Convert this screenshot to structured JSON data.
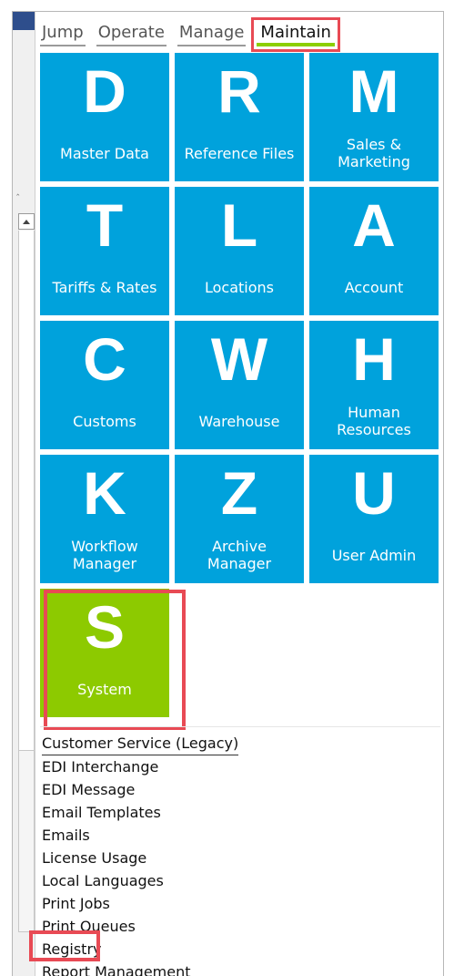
{
  "tabs": [
    {
      "label": "Jump"
    },
    {
      "label": "Operate"
    },
    {
      "label": "Manage"
    },
    {
      "label": "Maintain",
      "active": true
    }
  ],
  "tiles": [
    {
      "letter": "D",
      "label": "Master Data"
    },
    {
      "letter": "R",
      "label": "Reference Files"
    },
    {
      "letter": "M",
      "label": "Sales & Marketing"
    },
    {
      "letter": "T",
      "label": "Tariffs & Rates"
    },
    {
      "letter": "L",
      "label": "Locations"
    },
    {
      "letter": "A",
      "label": "Account"
    },
    {
      "letter": "C",
      "label": "Customs"
    },
    {
      "letter": "W",
      "label": "Warehouse"
    },
    {
      "letter": "H",
      "label": "Human Resources"
    },
    {
      "letter": "K",
      "label": "Workflow Manager"
    },
    {
      "letter": "Z",
      "label": "Archive Manager"
    },
    {
      "letter": "U",
      "label": "User Admin"
    },
    {
      "letter": "S",
      "label": "System"
    }
  ],
  "menu": [
    "Customer Service (Legacy)",
    "EDI Interchange",
    "EDI Message",
    "Email Templates",
    "Emails",
    "License Usage",
    "Local Languages",
    "Print Jobs",
    "Print Queues",
    "Registry",
    "Report Management"
  ],
  "colors": {
    "tile_blue": "#00a2dc",
    "tile_green": "#8dca00",
    "highlight_red": "#e84a54",
    "active_tab_underline": "#8ccf00"
  }
}
